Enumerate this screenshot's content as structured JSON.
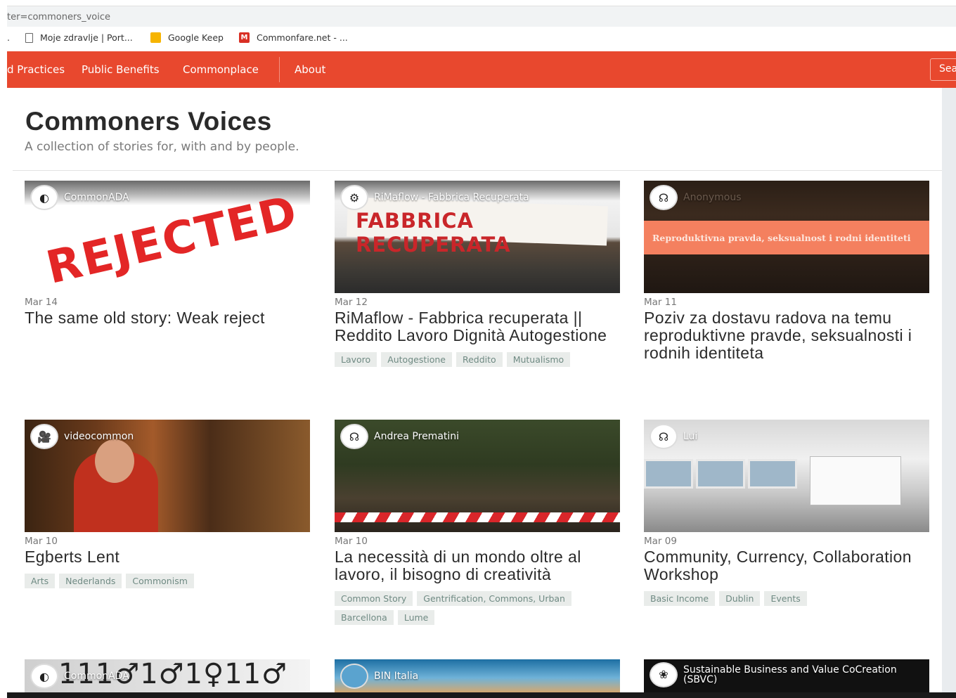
{
  "browser": {
    "url_fragment": "ter=commoners_voice",
    "bookmarks": [
      {
        "label": "Moje zdravlje | Port...",
        "icon": "page-icon"
      },
      {
        "label": "Google Keep",
        "icon": "keep-icon"
      },
      {
        "label": "Commonfare.net - ...",
        "icon": "gmail-icon"
      }
    ]
  },
  "nav": {
    "items": [
      "d Practices",
      "Public Benefits",
      "Commonplace",
      "About"
    ],
    "search_label": "Sea"
  },
  "page": {
    "title": "Commoners Voices",
    "subtitle": "A collection of stories for, with and by people."
  },
  "cards": [
    {
      "author": "CommonADA",
      "date": "Mar 14",
      "title": "The same old story: Weak reject",
      "image_text": "REJECTED",
      "tags": []
    },
    {
      "author": "RiMaflow - Fabbrica Recuperata",
      "date": "Mar 12",
      "title": "RiMaflow - Fabbrica recuperata || Reddito Lavoro Dignità Autogestione",
      "image_text": "FABBRICA RECUPERATA",
      "tags": [
        "Lavoro",
        "Autogestione",
        "Reddito",
        "Mutualismo"
      ]
    },
    {
      "author": "Anonymous",
      "date": "Mar 11",
      "title": "Poziv za dostavu radova na temu reproduktivne pravde, seksualnosti i rodnih identiteta",
      "image_text": "Reproduktivna pravda, seksualnost i rodni identiteti",
      "tags": []
    },
    {
      "author": "videocommon",
      "date": "Mar 10",
      "title": "Egberts Lent",
      "tags": [
        "Arts",
        "Nederlands",
        "Commonism"
      ]
    },
    {
      "author": "Andrea Prematini",
      "date": "Mar 10",
      "title": "La necessità di un mondo oltre al lavoro, il bisogno di creatività",
      "tags": [
        "Common Story",
        "Gentrification, Commons, Urban",
        "Barcellona",
        "Lume"
      ]
    },
    {
      "author": "Lui",
      "date": "Mar 09",
      "title": "Community, Currency, Collaboration Workshop",
      "tags": [
        "Basic Income",
        "Dublin",
        "Events"
      ]
    },
    {
      "author": "CommonADA",
      "image_text": "111♂1♂1♀11♂"
    },
    {
      "author": "BIN Italia"
    },
    {
      "author": "Sustainable Business and Value CoCreation (SBVC)"
    }
  ]
}
